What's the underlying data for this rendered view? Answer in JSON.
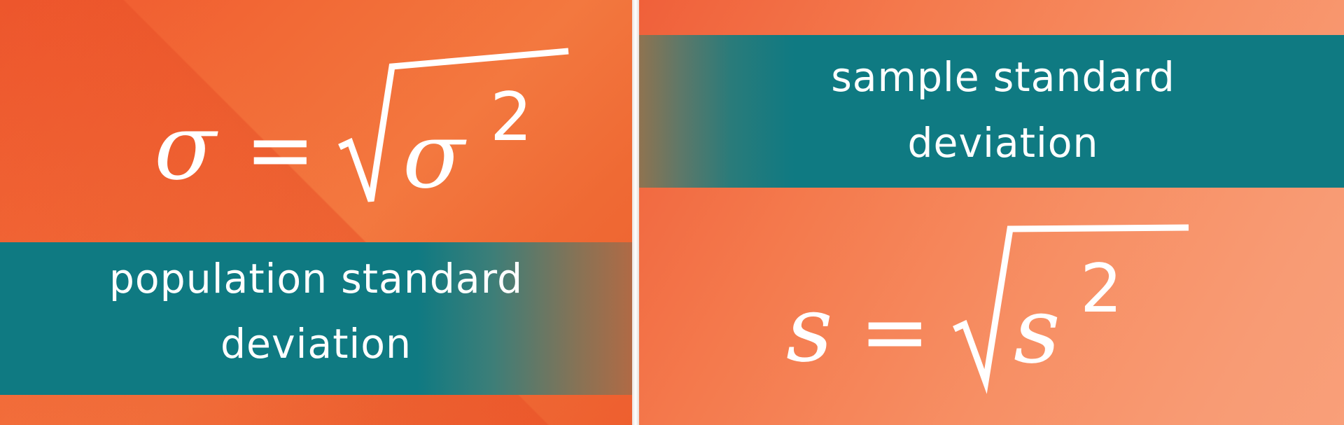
{
  "left": {
    "formula": {
      "lhs": "σ",
      "equals": "=",
      "radicand": "σ",
      "exponent": "2"
    },
    "label_line1": "population standard",
    "label_line2": "deviation"
  },
  "right": {
    "label_line1": "sample standard",
    "label_line2": "deviation",
    "formula": {
      "lhs": "s",
      "equals": "=",
      "radicand": "s",
      "exponent": "2"
    }
  },
  "colors": {
    "orange": "#f0562d",
    "teal": "#0f7a82",
    "white": "#ffffff"
  }
}
